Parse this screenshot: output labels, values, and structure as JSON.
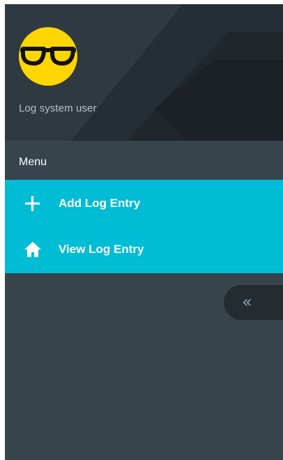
{
  "header": {
    "user_name": "Log system user",
    "avatar_icon": "sunglasses-face-icon"
  },
  "menu": {
    "heading": "Menu",
    "items": [
      {
        "label": "Add Log Entry",
        "icon": "plus-icon"
      },
      {
        "label": "View Log Entry",
        "icon": "home-icon"
      }
    ]
  },
  "collapse": {
    "glyph": "«",
    "icon": "double-chevron-left-icon"
  },
  "colors": {
    "sidebar_bg": "#37444c",
    "header_bg": "#2f3941",
    "accent": "#00bcd4",
    "avatar_yellow": "#ffd600",
    "collapse_tab": "#242c32"
  }
}
